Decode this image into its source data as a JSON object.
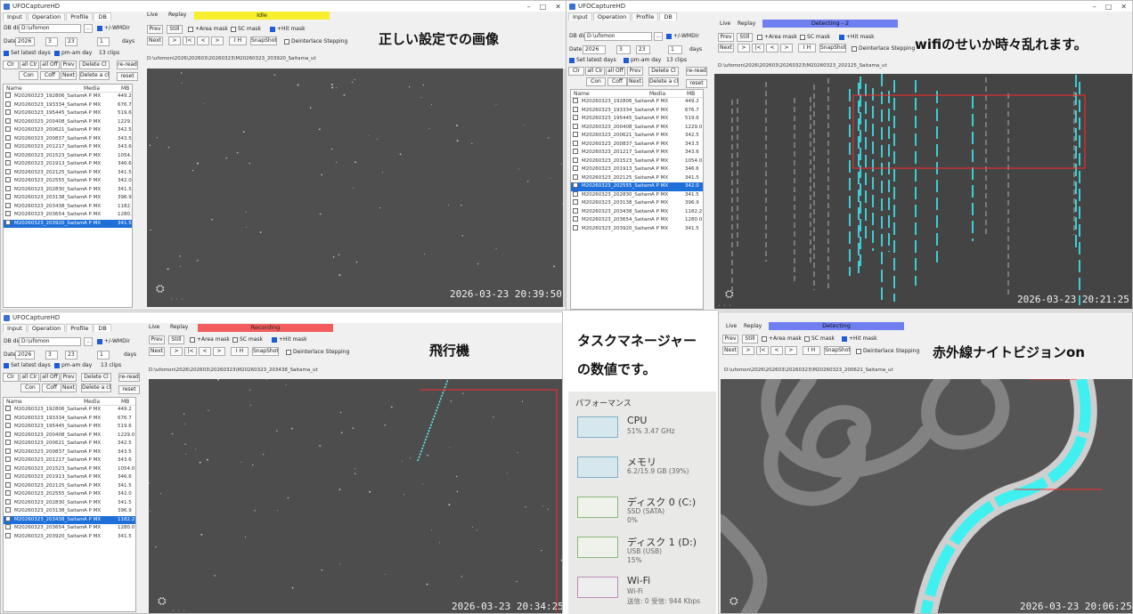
{
  "app_title": "UFOCaptureHD",
  "tabs": [
    "Input",
    "Operation",
    "Profile",
    "DB"
  ],
  "tabs_alt": [
    "Input",
    "Operation",
    "Profile",
    "DB"
  ],
  "tabs2": [
    "Live",
    "Replay"
  ],
  "status": {
    "p1": "Idle",
    "p2": "Detecting - 2",
    "p3": "Recording",
    "p4": "Detecting"
  },
  "db_dir_label": "DB dir",
  "db_dir_value": "D:\\ufomon",
  "rmdir_label": "+/-WMDir",
  "date_label": "Date",
  "date_year": "2026",
  "date_month": "3",
  "date_day": "23",
  "days_value": "1",
  "days_label": "days",
  "toolbar": {
    "prev": "Prev",
    "still": "Still",
    "next": "Next",
    "area_mask": "+Area mask",
    "sc_mask": "SC mask",
    "hit_mask": "+Hit mask",
    "snapshot": "SnapShot",
    "nav_first": "|<",
    "nav_prev": "<",
    "nav_next": ">",
    "nav_last": ">|",
    "nav_rev": "|<<",
    "nav_fwd": ">",
    "lh": "I H",
    "deinterlace": "Deinterlace Stepping"
  },
  "set_latest": "Set latest days",
  "pm_day": "pm-am day",
  "clips_count": "13 clips",
  "btns": {
    "clr": "Clr",
    "all_clr": "all Clr",
    "all_off": "all Off",
    "prev": "Prev",
    "delete": "Delete Cl",
    "reread": "re-read",
    "con": "Con",
    "coff": "Coff",
    "next": "Next",
    "delete_clip": "Delete a clip",
    "reset": "reset"
  },
  "list_headers": {
    "name": "Name",
    "media": "Media",
    "mb": "MB"
  },
  "files": [
    {
      "name": "M20260323_192806_Saitam",
      "media": "A P MX",
      "mb": "449.2"
    },
    {
      "name": "M20260323_193334_Saitam",
      "media": "A P MX",
      "mb": "676.7"
    },
    {
      "name": "M20260323_195445_Saitam",
      "media": "A P MX",
      "mb": "519.6"
    },
    {
      "name": "M20260323_200408_Saitam",
      "media": "A P MX",
      "mb": "1229.0"
    },
    {
      "name": "M20260323_200621_Saitam",
      "media": "A P MX",
      "mb": "342.5"
    },
    {
      "name": "M20260323_200837_Saitam",
      "media": "A P MX",
      "mb": "343.5"
    },
    {
      "name": "M20260323_201217_Saitam",
      "media": "A P MX",
      "mb": "343.6"
    },
    {
      "name": "M20260323_201523_Saitam",
      "media": "A P MX",
      "mb": "1054.0"
    },
    {
      "name": "M20260323_201913_Saitam",
      "media": "A P MX",
      "mb": "346.6"
    },
    {
      "name": "M20260323_202125_Saitam",
      "media": "A P MX",
      "mb": "341.5"
    },
    {
      "name": "M20260323_202555_Saitam",
      "media": "A P MX",
      "mb": "342.0"
    },
    {
      "name": "M20260323_202830_Saitam",
      "media": "A P MX",
      "mb": "341.5"
    },
    {
      "name": "M20260323_203138_Saitam",
      "media": "A P MX",
      "mb": "396.9"
    },
    {
      "name": "M20260323_203438_Saitam",
      "media": "A P MX",
      "mb": "1182.2"
    },
    {
      "name": "M20260323_203654_Saitam",
      "media": "A P MX",
      "mb": "1280.0"
    },
    {
      "name": "M20260323_203920_Saitam",
      "media": "A P MX",
      "mb": "341.5"
    }
  ],
  "paths": {
    "p1": "D:\\ufomon\\2026\\202603\\20260323\\M20260323_203920_Saitama_ut",
    "p2": "D:\\ufomon\\2026\\202603\\20260323\\M20260323_202125_Saitama_ut",
    "p3": "D:\\ufomon\\2026\\202603\\20260323\\M20260323_203438_Saitama_ut",
    "p4": "D:\\ufomon\\2026\\202603\\20260323\\M20260323_200621_Saitama_ut"
  },
  "stamps": {
    "p1": "2026-03-23 20:39:50",
    "p2": "2026-03-23 20:21:25",
    "p3": "2026-03-23 20:34:25",
    "p4": "2026-03-23 20:06:25"
  },
  "captions": {
    "p1": "正しい設定での画像",
    "p2": "wifiのせいか時々乱れます。",
    "p3": "飛行機",
    "p4a": "タスクマネージャー",
    "p4b": "の数値です。",
    "p5": "赤外線ナイトビジョンon"
  },
  "perf": {
    "title": "パフォーマンス",
    "items": [
      {
        "name": "CPU",
        "line1": "51% 3.47 GHz",
        "line2": ""
      },
      {
        "name": "メモリ",
        "line1": "6.2/15.9 GB (39%)",
        "line2": ""
      },
      {
        "name": "ディスク 0 (C:)",
        "line1": "SSD (SATA)",
        "line2": "0%"
      },
      {
        "name": "ディスク 1 (D:)",
        "line1": "USB (USB)",
        "line2": "15%"
      },
      {
        "name": "Wi-Fi",
        "line1": "Wi-Fi",
        "line2": "送信: 0 受信: 944 Kbps"
      }
    ]
  },
  "colors": {
    "idle": "#f7ef2c",
    "detecting": "#6f7ff0",
    "recording": "#f25c5c",
    "selection": "#1e6fd8"
  }
}
